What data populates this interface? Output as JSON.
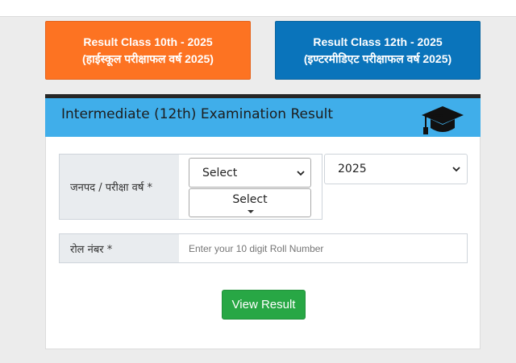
{
  "tiles": {
    "class10": {
      "line1": "Result Class 10th - 2025",
      "line2": "(हाईस्कूल परीक्षाफल वर्ष 2025)",
      "color": "#fd7322"
    },
    "class12": {
      "line1": "Result Class 12th - 2025",
      "line2": "(इण्टरमीडिएट परीक्षाफल वर्ष 2025)",
      "color": "#0a74bb"
    }
  },
  "card": {
    "title": "Intermediate (12th) Examination Result",
    "header_color": "#40aeea",
    "header_icon": "graduation-cap-icon"
  },
  "form": {
    "district_label": "जनपद / परीक्षा वर्ष *",
    "district_select_value": "Select",
    "exam_group_select_value": "Select",
    "year_select_value": "2025",
    "roll_label": "रोल नंबर *",
    "roll_placeholder": "Enter your 10 digit Roll Number",
    "submit_label": "View Result",
    "submit_color": "#28a745"
  }
}
